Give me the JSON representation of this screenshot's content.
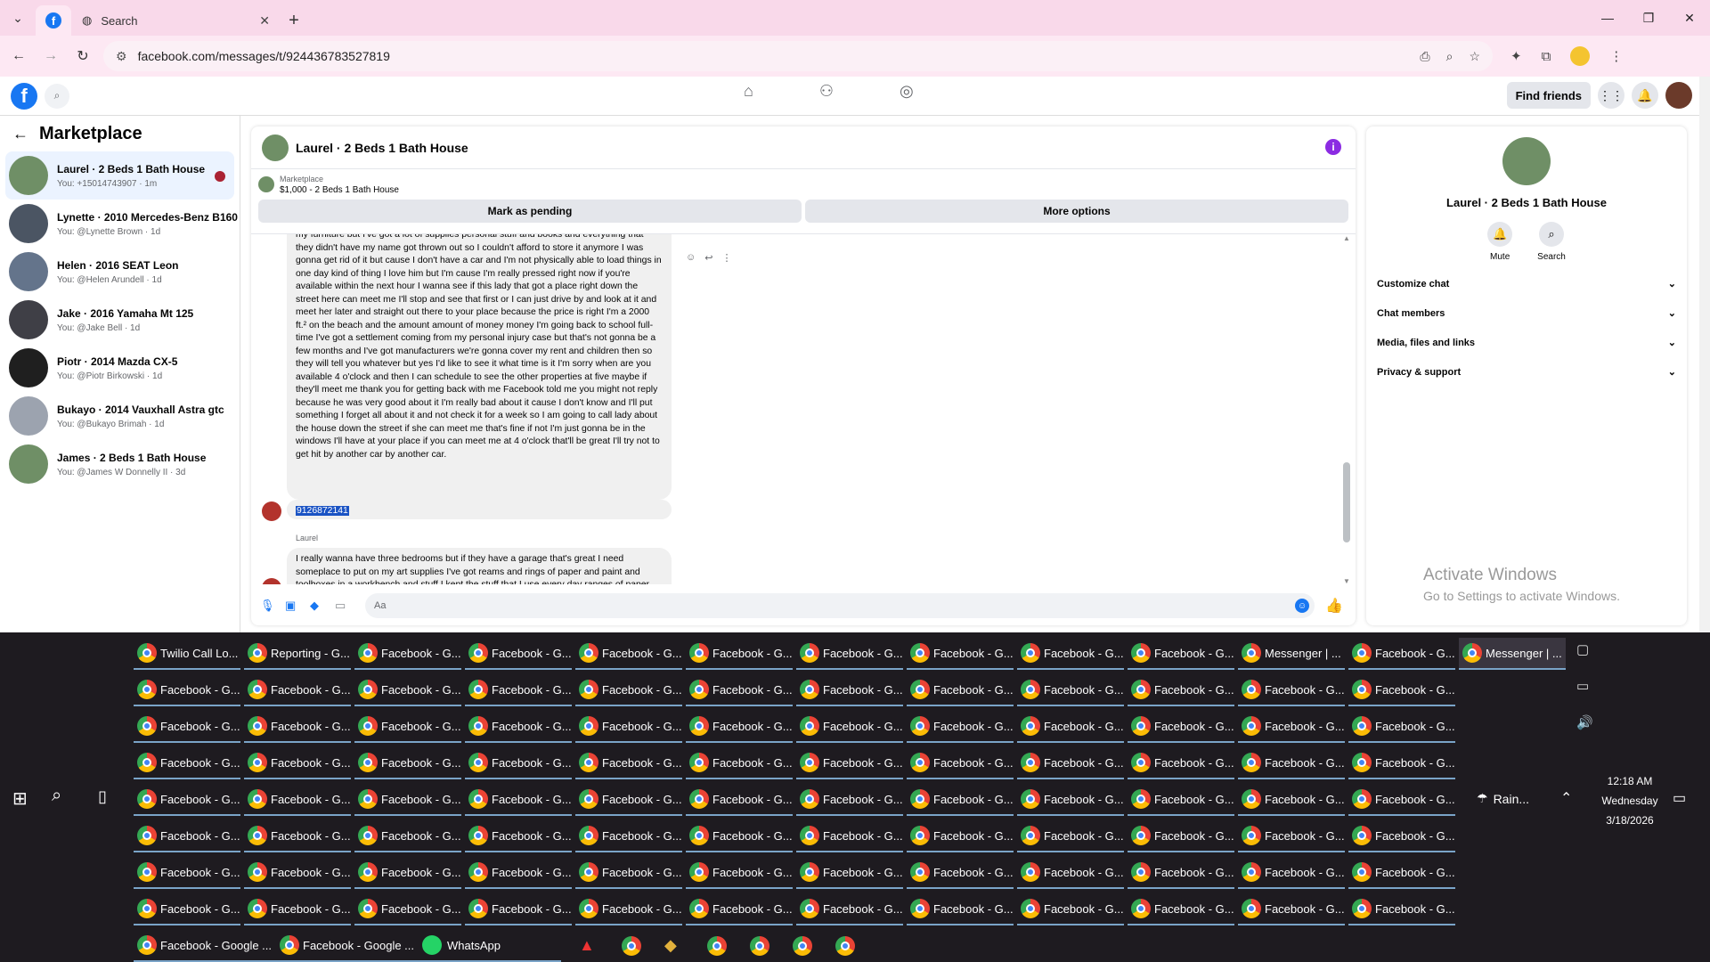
{
  "browser": {
    "tabs": [
      {
        "label": ""
      },
      {
        "label": "Search"
      }
    ],
    "url": "facebook.com/messages/t/924436783527819"
  },
  "fb": {
    "find_friends": "Find friends"
  },
  "sidebar": {
    "title": "Marketplace",
    "conversations": [
      {
        "name": "Laurel · 2 Beds 1 Bath House",
        "sub": "You: +15014743907 · 1m",
        "color": "#6f8f66"
      },
      {
        "name": "Lynette · 2010 Mercedes-Benz B160",
        "sub": "You: @Lynette Brown · 1d",
        "color": "#4b5563"
      },
      {
        "name": "Helen · 2016 SEAT Leon",
        "sub": "You: @Helen Arundell · 1d",
        "color": "#64748b"
      },
      {
        "name": "Jake · 2016 Yamaha Mt 125",
        "sub": "You: @Jake Bell · 1d",
        "color": "#3f3f46"
      },
      {
        "name": "Piotr · 2014 Mazda CX-5",
        "sub": "You: @Piotr Birkowski · 1d",
        "color": "#1f1f1f"
      },
      {
        "name": "Bukayo · 2014 Vauxhall Astra gtc",
        "sub": "You: @Bukayo Brimah · 1d",
        "color": "#9ca3af"
      },
      {
        "name": "James · 2 Beds 1 Bath House",
        "sub": "You: @James W Donnelly II · 3d",
        "color": "#6f8f66"
      }
    ]
  },
  "chat": {
    "title": "Laurel · 2 Beds 1 Bath House",
    "marketplace_label": "Marketplace",
    "price_line": "$1,000 - 2 Beds 1 Bath House",
    "mark_pending": "Mark as pending",
    "more_options": "More options",
    "message1": "my furniture but I've got a lot of supplies personal stuff and books and everything that they didn't have my name got thrown out so I couldn't afford to store it anymore I was gonna get rid of it but cause I don't have a car and I'm not physically able to load things in one day kind of thing I love him but I'm cause I'm really pressed right now if you're available within the next hour I wanna see if this lady that got a place right down the street here can meet me I'll stop and see that first or I can just drive by and look at it and meet her later and straight out there to your place because the price is right I'm a 2000 ft.² on the beach and the amount amount of money money I'm going back to school full-time I've got a settlement coming from my personal injury case but that's not gonna be a few months and I've got manufacturers we're gonna cover my rent and children then so they will tell you whatever but yes I'd like to see it what time is it I'm sorry when are you available 4 o'clock and then I can schedule to see the other properties at five maybe if they'll meet me thank you for getting back with me Facebook told me you might not reply because he was very good about it I'm really bad about it cause I don't know and I'll put something I forget all about it and not check it for a week so I am going to call lady about the house down the street if she can meet me that's fine if not I'm just gonna be in the windows I'll have at your place if you can meet me at 4 o'clock that'll be great I'll try not to get hit by another car by another car.",
    "message2": "9126872141",
    "sender_name": "Laurel",
    "message3": "I really wanna have three bedrooms but if they have a garage that's great I need someplace to put on my art supplies I've got reams and rings of paper and paint and toolboxes in a workbench and stuff I kept the stuff that I use every day ranges of paper and paint it",
    "composer_placeholder": "Aa"
  },
  "info": {
    "title": "Laurel · 2 Beds 1 Bath House",
    "mute": "Mute",
    "search": "Search",
    "rows": [
      "Customize chat",
      "Chat members",
      "Media, files and links",
      "Privacy & support"
    ]
  },
  "watermark": {
    "line1": "Activate Windows",
    "line2": "Go to Settings to activate Windows."
  },
  "taskbar": {
    "rows": [
      [
        "Twilio Call Lo...",
        "Reporting - G...",
        "Facebook - G...",
        "Facebook - G...",
        "Facebook - G...",
        "Facebook - G...",
        "Facebook - G...",
        "Facebook - G...",
        "Facebook - G...",
        "Facebook - G...",
        "Messenger | ...",
        "Facebook - G...",
        "Messenger | ..."
      ],
      [
        "Facebook - G...",
        "Facebook - G...",
        "Facebook - G...",
        "Facebook - G...",
        "Facebook - G...",
        "Facebook - G...",
        "Facebook - G...",
        "Facebook - G...",
        "Facebook - G...",
        "Facebook - G...",
        "Facebook - G...",
        "Facebook - G..."
      ],
      [
        "Facebook - G...",
        "Facebook - G...",
        "Facebook - G...",
        "Facebook - G...",
        "Facebook - G...",
        "Facebook - G...",
        "Facebook - G...",
        "Facebook - G...",
        "Facebook - G...",
        "Facebook - G...",
        "Facebook - G...",
        "Facebook - G..."
      ],
      [
        "Facebook - G...",
        "Facebook - G...",
        "Facebook - G...",
        "Facebook - G...",
        "Facebook - G...",
        "Facebook - G...",
        "Facebook - G...",
        "Facebook - G...",
        "Facebook - G...",
        "Facebook - G...",
        "Facebook - G...",
        "Facebook - G..."
      ],
      [
        "Facebook - G...",
        "Facebook - G...",
        "Facebook - G...",
        "Facebook - G...",
        "Facebook - G...",
        "Facebook - G...",
        "Facebook - G...",
        "Facebook - G...",
        "Facebook - G...",
        "Facebook - G...",
        "Facebook - G...",
        "Facebook - G..."
      ],
      [
        "Facebook - G...",
        "Facebook - G...",
        "Facebook - G...",
        "Facebook - G...",
        "Facebook - G...",
        "Facebook - G...",
        "Facebook - G...",
        "Facebook - G...",
        "Facebook - G...",
        "Facebook - G...",
        "Facebook - G...",
        "Facebook - G..."
      ],
      [
        "Facebook - G...",
        "Facebook - G...",
        "Facebook - G...",
        "Facebook - G...",
        "Facebook - G...",
        "Facebook - G...",
        "Facebook - G...",
        "Facebook - G...",
        "Facebook - G...",
        "Facebook - G...",
        "Facebook - G...",
        "Facebook - G..."
      ],
      [
        "Facebook - G...",
        "Facebook - G...",
        "Facebook - G...",
        "Facebook - G...",
        "Facebook - G...",
        "Facebook - G...",
        "Facebook - G...",
        "Facebook - G...",
        "Facebook - G...",
        "Facebook - G...",
        "Facebook - G...",
        "Facebook - G..."
      ]
    ],
    "bottom": [
      "Facebook - Google ...",
      "Facebook - Google ...",
      "WhatsApp"
    ],
    "weather": "Rain...",
    "time": "12:18 AM",
    "day": "Wednesday",
    "date": "3/18/2026"
  }
}
